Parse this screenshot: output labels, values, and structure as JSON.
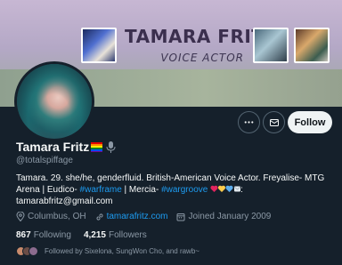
{
  "banner": {
    "title": "TAMARA FRITZ",
    "subtitle": "VOICE ACTOR"
  },
  "actions": {
    "follow_label": "Follow"
  },
  "profile": {
    "name": "Tamara Fritz",
    "handle": "@totalspiffage",
    "bio_1": "Tamara. 29. she/he, genderfluid. British-American Voice Actor. Freyalise- MTG Arena | Eudico- ",
    "bio_link_1": "#warframe",
    "bio_2": " | Mercia- ",
    "bio_link_2": "#wargroove",
    "bio_3": "tamarabfritz@gmail.com",
    "location": "Columbus, OH",
    "website": "tamarafritz.com",
    "joined": "Joined January 2009"
  },
  "stats": {
    "following_count": "867",
    "following_label": "Following",
    "followers_count": "4,215",
    "followers_label": "Followers"
  },
  "followed_by": "Followed by Sixelona, SungWon Cho, and rawb~",
  "colors": {
    "background": "#15202b",
    "link": "#1d9bf0",
    "muted": "#8b98a5"
  }
}
